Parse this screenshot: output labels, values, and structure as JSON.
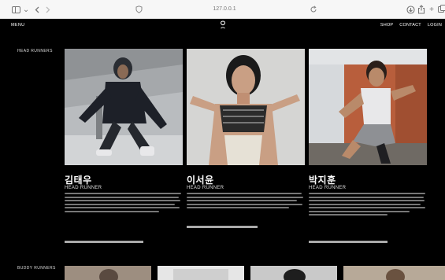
{
  "browser": {
    "address": "127.0.0.1"
  },
  "site": {
    "nav_menu": "MENU",
    "nav_shop": "SHOP",
    "nav_contact": "CONTACT",
    "nav_login": "LOGIN",
    "section_head": "HEAD RUNNERS",
    "section_buddy": "BUDDY RUNNERS",
    "runners": [
      {
        "name": "김태우",
        "role": "HEAD RUNNER"
      },
      {
        "name": "이서윤",
        "role": "HEAD RUNNER"
      },
      {
        "name": "박지훈",
        "role": "HEAD RUNNER"
      }
    ]
  },
  "colors": {
    "site_bg": "#000000",
    "chrome_bg": "#f7f7f7",
    "text": "#ffffff"
  }
}
